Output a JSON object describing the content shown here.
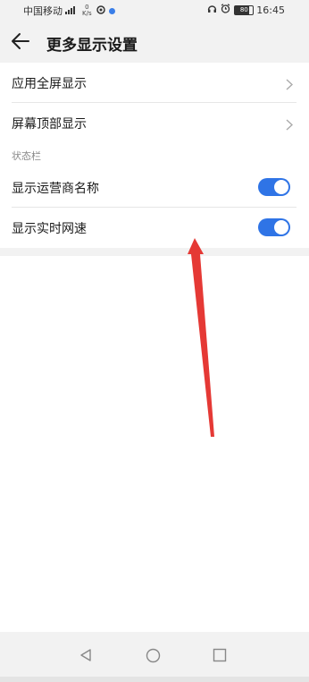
{
  "status_bar": {
    "carrier": "中国移动",
    "net_speed_value": "0",
    "net_speed_unit": "K/s",
    "battery": "80",
    "time": "16:45"
  },
  "header": {
    "title": "更多显示设置"
  },
  "settings": {
    "app_fullscreen": "应用全屏显示",
    "screen_top_display": "屏幕顶部显示",
    "status_bar_section": "状态栏",
    "show_carrier_name": "显示运营商名称",
    "show_carrier_name_on": true,
    "show_realtime_speed": "显示实时网速",
    "show_realtime_speed_on": true
  },
  "colors": {
    "accent": "#2f74e6",
    "annotation_arrow": "#e53935"
  }
}
